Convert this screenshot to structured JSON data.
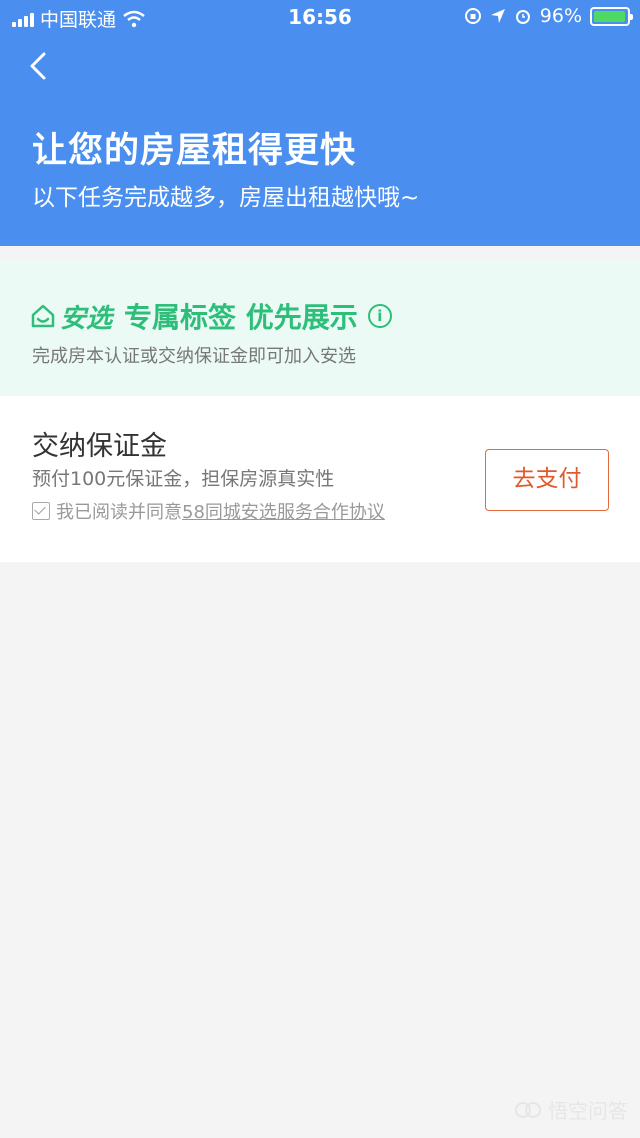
{
  "status_bar": {
    "carrier": "中国联通",
    "time": "16:56",
    "battery": "96%",
    "battery_level": 0.96
  },
  "header": {
    "back_icon": "chevron-left-icon",
    "title": "让您的房屋租得更快",
    "subtitle": "以下任务完成越多，房屋出租越快哦~"
  },
  "anxuan": {
    "logo_text": "安选",
    "headline": "专属标签 优先展示",
    "info_icon": "i",
    "description": "完成房本认证或交纳保证金即可加入安选",
    "accent_color": "#2dbf7a"
  },
  "deposit_task": {
    "title": "交纳保证金",
    "description": "预付100元保证金，担保房源真实性",
    "agree_prefix": "我已阅读并同意",
    "agree_link": "58同城安选服务合作协议",
    "agree_checked": true,
    "pay_button": "去支付",
    "button_color": "#e05a2b"
  },
  "watermark": {
    "text": "悟空问答"
  },
  "colors": {
    "header_bg": "#4a8ff0",
    "page_bg": "#f4f4f4",
    "anxuan_bg": "#ebfaf4"
  }
}
